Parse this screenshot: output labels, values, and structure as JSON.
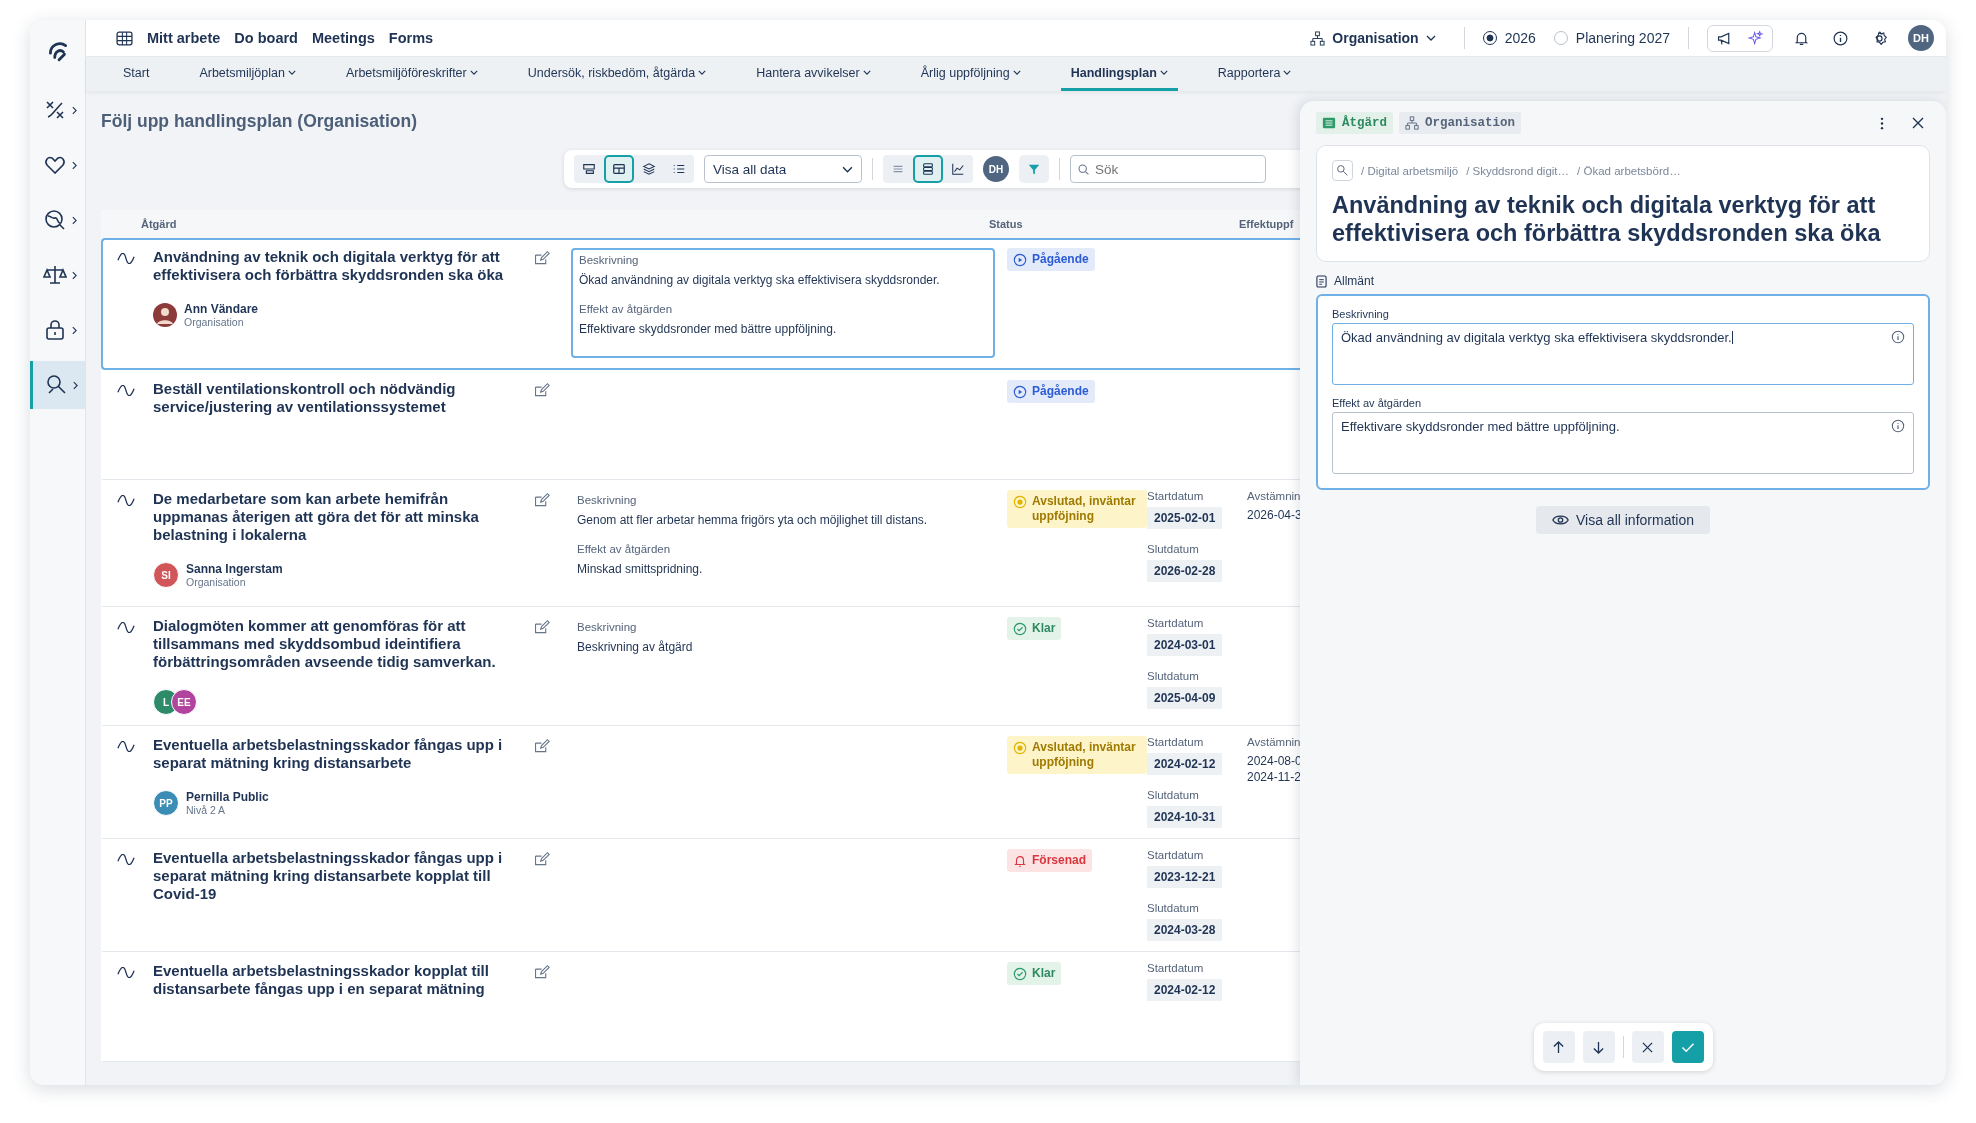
{
  "topbar": {
    "links": [
      "Mitt arbete",
      "Do board",
      "Meetings",
      "Forms"
    ],
    "org_selector": "Organisation",
    "years": [
      {
        "label": "2026",
        "selected": true
      },
      {
        "label": "Planering 2027",
        "selected": false
      }
    ],
    "avatar": "DH"
  },
  "sidebar": {
    "items": [
      {
        "kind": "tools",
        "selected": false
      },
      {
        "kind": "heart",
        "selected": false
      },
      {
        "kind": "globe",
        "selected": false
      },
      {
        "kind": "scales",
        "selected": false
      },
      {
        "kind": "lock",
        "selected": false
      },
      {
        "kind": "search",
        "selected": true
      }
    ]
  },
  "subnav": [
    {
      "label": "Start",
      "dropdown": false,
      "selected": false
    },
    {
      "label": "Arbetsmiljöplan",
      "dropdown": true,
      "selected": false
    },
    {
      "label": "Arbetsmiljöföreskrifter",
      "dropdown": true,
      "selected": false
    },
    {
      "label": "Undersök, riskbedöm, åtgärda",
      "dropdown": true,
      "selected": false
    },
    {
      "label": "Hantera avvikelser",
      "dropdown": true,
      "selected": false
    },
    {
      "label": "Årlig uppföljning",
      "dropdown": true,
      "selected": false
    },
    {
      "label": "Handlingsplan",
      "dropdown": true,
      "selected": true
    },
    {
      "label": "Rapportera",
      "dropdown": true,
      "selected": false
    }
  ],
  "page_title": "Följ upp handlingsplan (Organisation)",
  "toolbar": {
    "view_buttons": [
      {
        "kind": "cards",
        "selected": false
      },
      {
        "kind": "table",
        "selected": true
      },
      {
        "kind": "layers",
        "selected": false
      },
      {
        "kind": "list",
        "selected": false
      }
    ],
    "data_filter": "Visa all data",
    "density_buttons": [
      {
        "kind": "compact",
        "selected": false
      },
      {
        "kind": "expanded",
        "selected": true
      }
    ],
    "avatar": "DH",
    "search_placeholder": "Sök"
  },
  "table": {
    "columns": [
      "Åtgärd",
      "Status",
      "Effektuppf"
    ],
    "rows": [
      {
        "selected": true,
        "title": "Användning av teknik och digitala verktyg för att effektivisera och förbättra skyddsronden ska öka",
        "people": {
          "avatars": [
            {
              "kind": "photo",
              "color": "#8c3a3a"
            }
          ],
          "name": "Ann Vändare",
          "unit": "Organisation"
        },
        "details": [
          {
            "label": "Beskrivning",
            "text": "Ökad användning av digitala verktyg ska effektivisera skyddsronder."
          },
          {
            "label": "Effekt av åtgärden",
            "text": "Effektivare skyddsronder med bättre uppföljning."
          }
        ],
        "status": {
          "kind": "in_progress",
          "label": "Pågående"
        }
      },
      {
        "selected": false,
        "title": "Beställ ventilationskontroll och nödvändig service/justering av ventilationssystemet",
        "status": {
          "kind": "in_progress",
          "label": "Pågående"
        }
      },
      {
        "selected": false,
        "title": "De medarbetare som kan arbete hemifrån uppmanas återigen att göra det för att minska belastning i lokalerna",
        "people": {
          "avatars": [
            {
              "kind": "initials",
              "initials": "SI",
              "color": "#d0565a"
            }
          ],
          "name": "Sanna Ingerstam",
          "unit": "Organisation"
        },
        "details": [
          {
            "label": "Beskrivning",
            "text": "Genom att fler arbetar hemma frigörs yta och möjlighet till distans."
          },
          {
            "label": "Effekt av åtgärden",
            "text": "Minskad smittspridning."
          }
        ],
        "status": {
          "kind": "awaiting",
          "label": "Avslutad, inväntar uppföjning"
        },
        "start": {
          "label": "Startdatum",
          "value": "2025-02-01"
        },
        "end": {
          "label": "Slutdatum",
          "value": "2026-02-28"
        },
        "followup": {
          "label": "Avstämnin",
          "values": [
            "2026-04-3"
          ]
        }
      },
      {
        "selected": false,
        "title": "Dialogmöten kommer att genomföras för att tillsammans med skyddsombud ideintifiera förbättringsområden avseende tidig samverkan.",
        "people": {
          "avatars": [
            {
              "kind": "initials",
              "initials": "L",
              "color": "#2e8b6a"
            },
            {
              "kind": "initials",
              "initials": "EE",
              "color": "#b0449e"
            }
          ]
        },
        "details": [
          {
            "label": "Beskrivning",
            "text": "Beskrivning av åtgärd"
          }
        ],
        "status": {
          "kind": "done",
          "label": "Klar"
        },
        "start": {
          "label": "Startdatum",
          "value": "2024-03-01"
        },
        "end": {
          "label": "Slutdatum",
          "value": "2025-04-09"
        }
      },
      {
        "selected": false,
        "title": "Eventuella arbetsbelastningsskador fångas upp i separat mätning kring distansarbete",
        "people": {
          "avatars": [
            {
              "kind": "initials",
              "initials": "PP",
              "color": "#3b8db5"
            }
          ],
          "name": "Pernilla Public",
          "unit": "Nivå 2 A"
        },
        "status": {
          "kind": "awaiting",
          "label": "Avslutad, inväntar uppföjning"
        },
        "start": {
          "label": "Startdatum",
          "value": "2024-02-12"
        },
        "end": {
          "label": "Slutdatum",
          "value": "2024-10-31"
        },
        "followup": {
          "label": "Avstämnin",
          "values": [
            "2024-08-0",
            "2024-11-2"
          ]
        }
      },
      {
        "selected": false,
        "title": "Eventuella arbetsbelastningsskador fångas upp i separat mätning kring distansarbete kopplat till Covid-19",
        "status": {
          "kind": "late",
          "label": "Försenad"
        },
        "start": {
          "label": "Startdatum",
          "value": "2023-12-21"
        },
        "end": {
          "label": "Slutdatum",
          "value": "2024-03-28"
        }
      },
      {
        "selected": false,
        "title": "Eventuella arbetsbelastningsskador kopplat till distansarbete fångas upp i en separat mätning",
        "status": {
          "kind": "done",
          "label": "Klar"
        },
        "start": {
          "label": "Startdatum",
          "value": "2024-02-12"
        }
      }
    ]
  },
  "panel": {
    "tags": [
      {
        "kind": "type",
        "label": "Åtgärd"
      },
      {
        "kind": "org",
        "label": "Organisation"
      }
    ],
    "breadcrumb": [
      "/ Digital arbetsmiljö",
      "/ Skyddsrond digit…",
      "/ Ökad arbetsbörd…"
    ],
    "title": "Användning av teknik och digitala verktyg för att effektivisera och förbättra skyddsronden ska öka",
    "section": "Allmänt",
    "fields": [
      {
        "label": "Beskrivning",
        "value": "Ökad användning av digitala verktyg ska effektivisera skyddsronder.",
        "focused": true
      },
      {
        "label": "Effekt av åtgärden",
        "value": "Effektivare skyddsronder med bättre uppföljning.",
        "focused": false
      }
    ],
    "show_all": "Visa all information"
  }
}
